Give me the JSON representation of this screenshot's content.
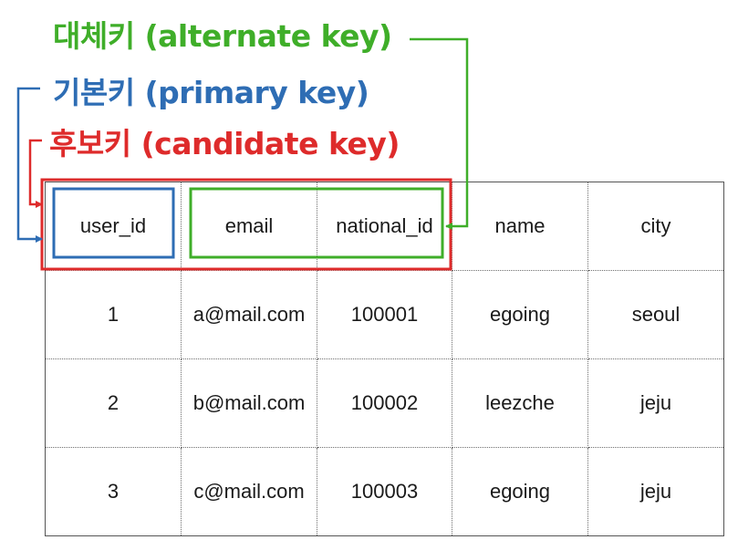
{
  "labels": {
    "alternate": "대체키 (alternate key)",
    "primary": "기본키 (primary key)",
    "candidate": "후보키 (candidate key)"
  },
  "colors": {
    "alternate": "#3fae29",
    "primary": "#2e6db4",
    "candidate": "#de2b2b"
  },
  "table": {
    "headers": [
      "user_id",
      "email",
      "national_id",
      "name",
      "city"
    ],
    "rows": [
      [
        "1",
        "a@mail.com",
        "100001",
        "egoing",
        "seoul"
      ],
      [
        "2",
        "b@mail.com",
        "100002",
        "leezche",
        "jeju"
      ],
      [
        "3",
        "c@mail.com",
        "100003",
        "egoing",
        "jeju"
      ]
    ]
  },
  "highlights": {
    "primary_key_columns": [
      "user_id"
    ],
    "alternate_key_columns": [
      "email",
      "national_id"
    ],
    "candidate_key_columns": [
      "user_id",
      "email",
      "national_id"
    ]
  }
}
